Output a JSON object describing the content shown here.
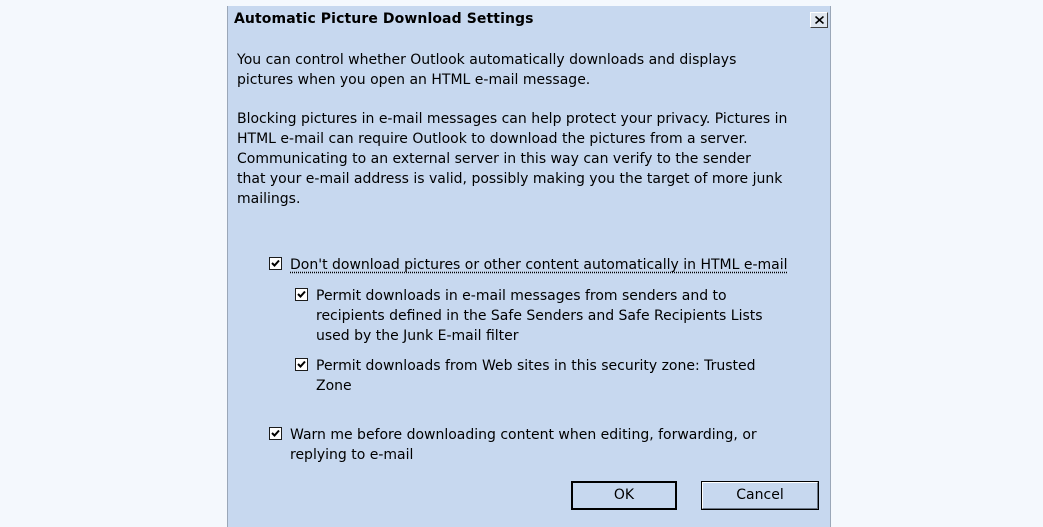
{
  "dialog": {
    "title": "Automatic Picture Download Settings",
    "close_icon": "close-x-icon",
    "paragraph1": "You can control whether Outlook automatically downloads and displays\npictures when you open an HTML e-mail message.",
    "paragraph2": "Blocking pictures in e-mail messages can help protect your privacy. Pictures in\nHTML e-mail can require Outlook to download the pictures from a server.\nCommunicating to an external server in this way can verify to the sender\nthat your e-mail address is valid, possibly making you the target of more junk\nmailings.",
    "options": [
      {
        "label": "Don't download pictures or other content automatically in HTML e-mail",
        "checked": true
      },
      {
        "label": "Permit downloads in e-mail messages from senders and to\nrecipients defined in the Safe Senders and Safe Recipients Lists\nused by the Junk E-mail filter",
        "checked": true
      },
      {
        "label": "Permit downloads from Web sites in this security zone: Trusted\nZone",
        "checked": true
      },
      {
        "label": "Warn me before downloading content when editing, forwarding, or\nreplying to e-mail",
        "checked": true
      }
    ],
    "ok_label": "OK",
    "cancel_label": "Cancel"
  }
}
